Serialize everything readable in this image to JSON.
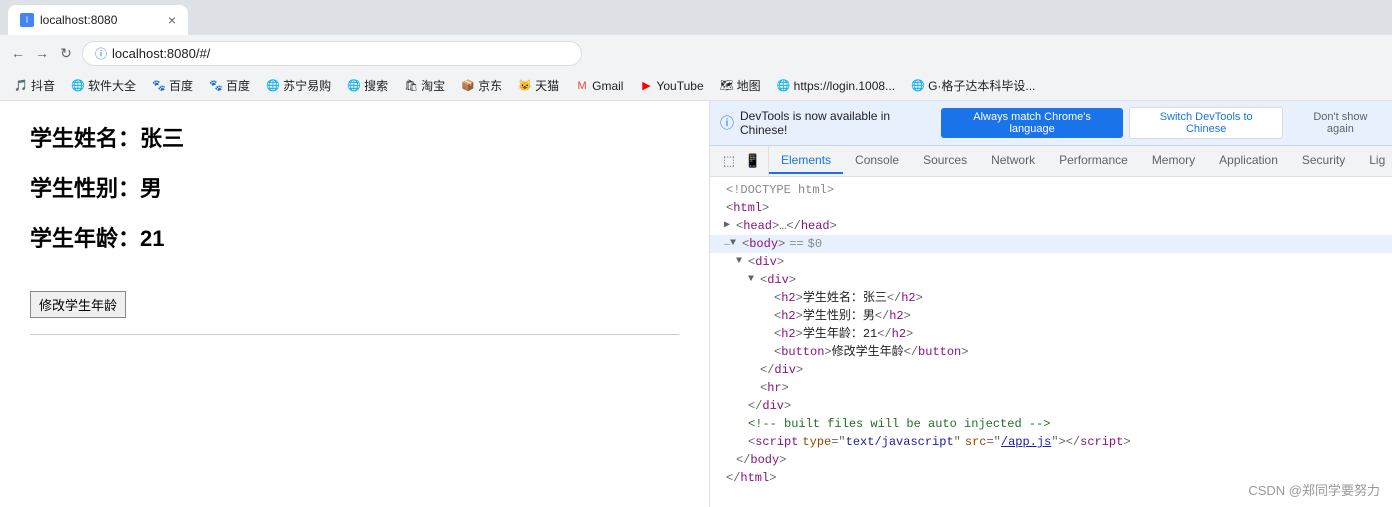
{
  "browser": {
    "nav_back": "←",
    "nav_forward": "→",
    "nav_refresh": "↻",
    "address": "localhost:8080/#/",
    "address_full": "① localhost:8080/#/"
  },
  "bookmarks": [
    {
      "label": "抖音",
      "icon": "🎵"
    },
    {
      "label": "软件大全",
      "icon": "🌐"
    },
    {
      "label": "百度",
      "icon": "🐾"
    },
    {
      "label": "百度",
      "icon": "🐾"
    },
    {
      "label": "苏宁易购",
      "icon": "🌐"
    },
    {
      "label": "搜索",
      "icon": "🌐"
    },
    {
      "label": "淘宝",
      "icon": "🛍"
    },
    {
      "label": "京东",
      "icon": "📦"
    },
    {
      "label": "天猫",
      "icon": "😺"
    },
    {
      "label": "Gmail",
      "icon": "✉"
    },
    {
      "label": "YouTube",
      "icon": "▶"
    },
    {
      "label": "地图",
      "icon": "🗺"
    },
    {
      "label": "https://login.1008...",
      "icon": "🌐"
    },
    {
      "label": "G·格子达本科毕设...",
      "icon": "🌐"
    }
  ],
  "tab": {
    "title": "localhost:8080",
    "favicon_color": "#4285f4"
  },
  "webpage": {
    "name_label": "学生姓名：",
    "name_value": "张三",
    "gender_label": "学生性别：",
    "gender_value": "男",
    "age_label": "学生年龄：",
    "age_value": "21",
    "button_label": "修改学生年龄"
  },
  "devtools": {
    "notification": "DevTools is now available in Chinese!",
    "btn_match": "Always match Chrome's language",
    "btn_switch": "Switch DevTools to Chinese",
    "btn_dismiss": "Don't show again",
    "tabs": [
      "Elements",
      "Console",
      "Sources",
      "Network",
      "Performance",
      "Memory",
      "Application",
      "Security",
      "Lig"
    ],
    "active_tab": "Elements"
  },
  "code": {
    "doctype": "<!DOCTYPE html>",
    "html_open": "<html>",
    "head_collapsed": "▶ <head>…</head>",
    "body_open": "▼ <body> == $0",
    "div_open": "▼ <div>",
    "inner_div_open": "▼ <div>",
    "h2_name": "<h2>学生姓名：张三</h2>",
    "h2_gender": "<h2>学生性别：男</h2>",
    "h2_age": "<h2>学生年龄：21</h2>",
    "button_el": "<button>修改学生年龄</button>",
    "inner_div_close": "</div>",
    "hr_el": "<hr>",
    "div_close": "</div>",
    "comment": "<!-- built files will be auto injected -->",
    "script_el": "<script type=\"text/javascript\" src=\"/app.js\"></script>",
    "body_close": "</body>",
    "html_close": "</html>"
  },
  "watermark": "CSDN @郑同学要努力"
}
